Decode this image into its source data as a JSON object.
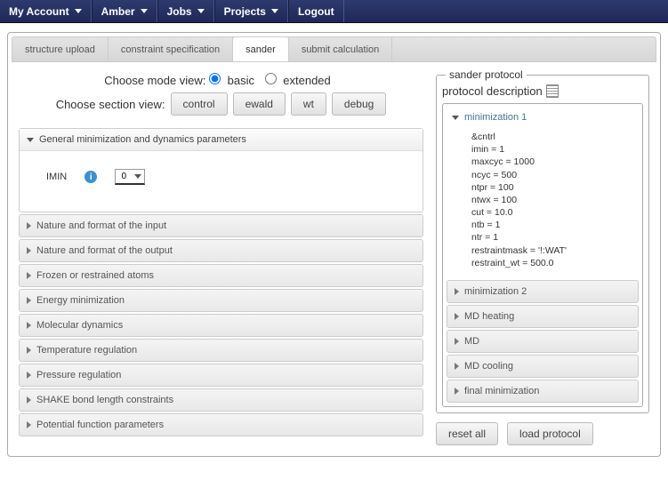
{
  "nav": {
    "items": [
      "My Account",
      "Amber",
      "Jobs",
      "Projects",
      "Logout"
    ],
    "has_dropdown": [
      true,
      true,
      true,
      true,
      false
    ]
  },
  "tabs": [
    "structure upload",
    "constraint specification",
    "sander",
    "submit calculation"
  ],
  "active_tab": 2,
  "mode": {
    "label": "Choose mode view:",
    "options": [
      "basic",
      "extended"
    ],
    "selected": "basic"
  },
  "section": {
    "label": "Choose section view:",
    "buttons": [
      "control",
      "ewald",
      "wt",
      "debug"
    ]
  },
  "accordion_open": {
    "title": "General minimization and dynamics parameters",
    "field_label": "IMIN",
    "field_value": "0"
  },
  "accordion_items": [
    "Nature and format of the input",
    "Nature and format of the output",
    "Frozen or restrained atoms",
    "Energy minimization",
    "Molecular dynamics",
    "Temperature regulation",
    "Pressure regulation",
    "SHAKE bond length constraints",
    "Potential function parameters"
  ],
  "protocol": {
    "legend": "sander protocol",
    "desc_label": "protocol description",
    "open_step": "minimization 1",
    "content_lines": [
      "&cntrl",
      "imin = 1",
      "maxcyc = 1000",
      "ncyc = 500",
      "ntpr = 100",
      "ntwx = 100",
      "cut = 10.0",
      "ntb = 1",
      "ntr = 1",
      "restraintmask = '!:WAT'",
      "restraint_wt = 500.0"
    ],
    "closed_steps": [
      "minimization 2",
      "MD heating",
      "MD",
      "MD cooling",
      "final minimization"
    ],
    "buttons": {
      "reset": "reset all",
      "load": "load protocol"
    }
  }
}
